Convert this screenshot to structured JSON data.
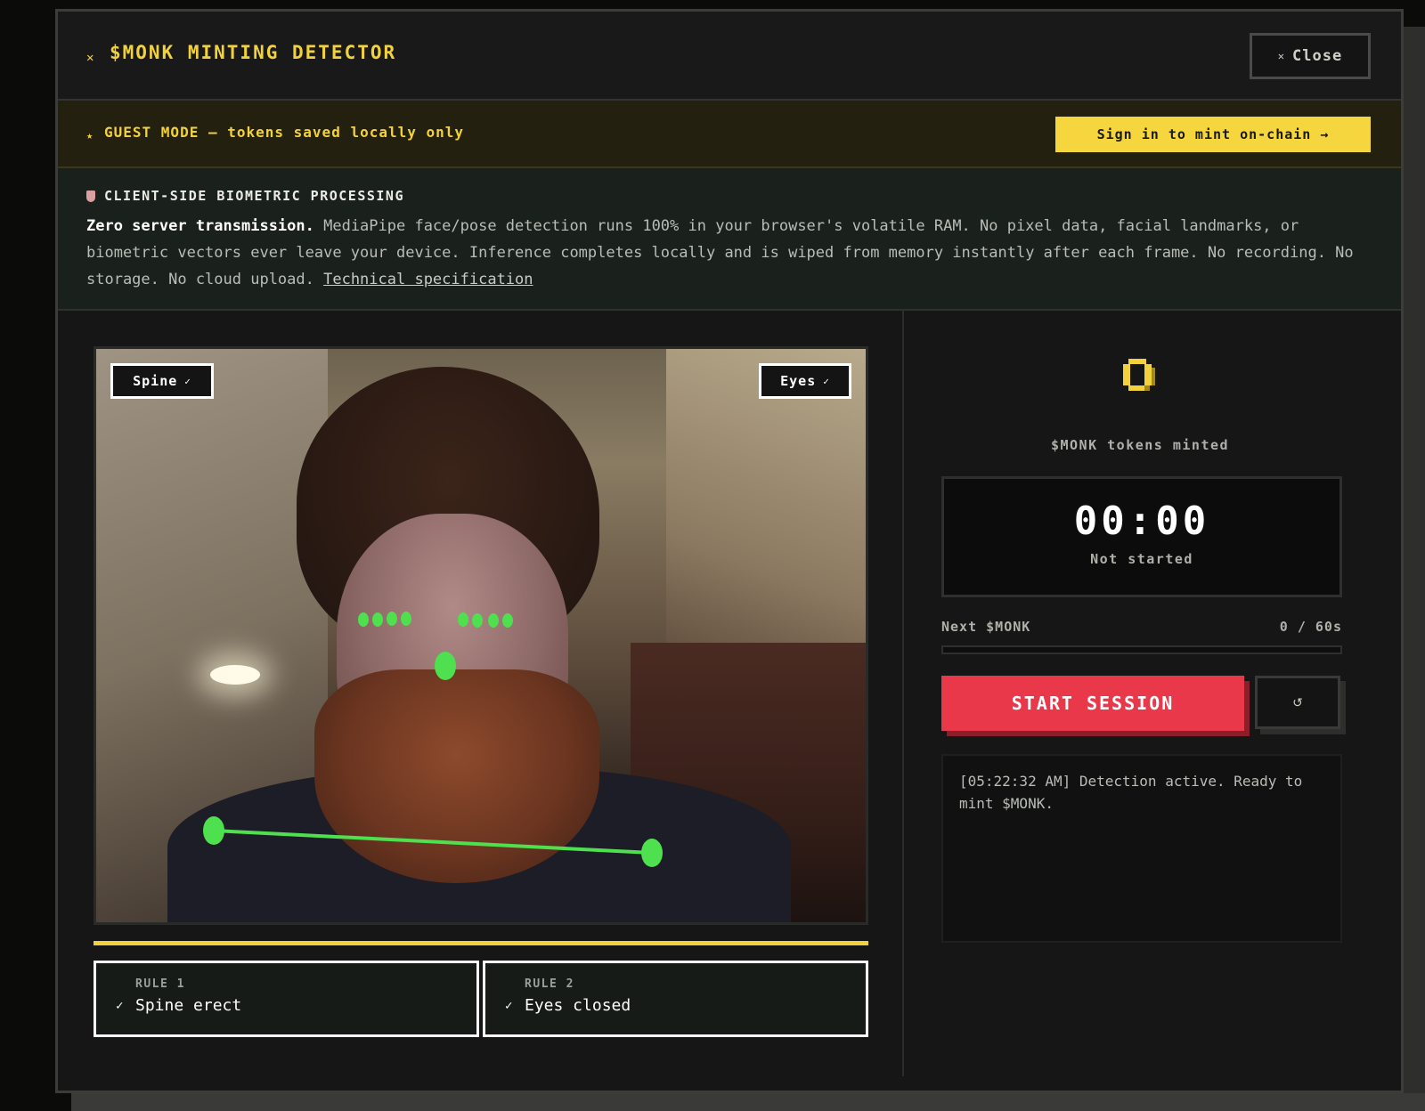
{
  "header": {
    "title": "$MONK MINTING DETECTOR",
    "close_label": "Close"
  },
  "guest": {
    "text": "GUEST MODE — tokens saved locally only",
    "signin_label": "Sign in to mint on-chain →"
  },
  "privacy": {
    "title": "CLIENT-SIDE BIOMETRIC PROCESSING",
    "lead": "Zero server transmission.",
    "body": " MediaPipe face/pose detection runs 100% in your browser's volatile RAM. No pixel data, facial landmarks, or biometric vectors ever leave your device. Inference completes locally and is wiped from memory instantly after each frame. No recording. No storage. No cloud upload. ",
    "link_label": "Technical specification"
  },
  "video": {
    "chips": [
      {
        "label": "Spine"
      },
      {
        "label": "Eyes"
      }
    ]
  },
  "rules": [
    {
      "label": "RULE 1",
      "text": "Spine erect"
    },
    {
      "label": "RULE 2",
      "text": "Eyes closed"
    }
  ],
  "stats": {
    "tokens_label": "$MONK tokens minted",
    "time": "00:00",
    "status": "Not started",
    "next_label": "Next $MONK",
    "next_value": "0 / 60s",
    "next_progress": 0
  },
  "controls": {
    "start_label": "START SESSION",
    "reset_icon": "↺"
  },
  "log": {
    "entries": [
      "[05:22:32 AM] Detection active. Ready to mint $MONK."
    ]
  },
  "colors": {
    "accent_yellow": "#f2d23c",
    "start_red": "#e8384a",
    "landmark_green": "#4ee04e"
  }
}
